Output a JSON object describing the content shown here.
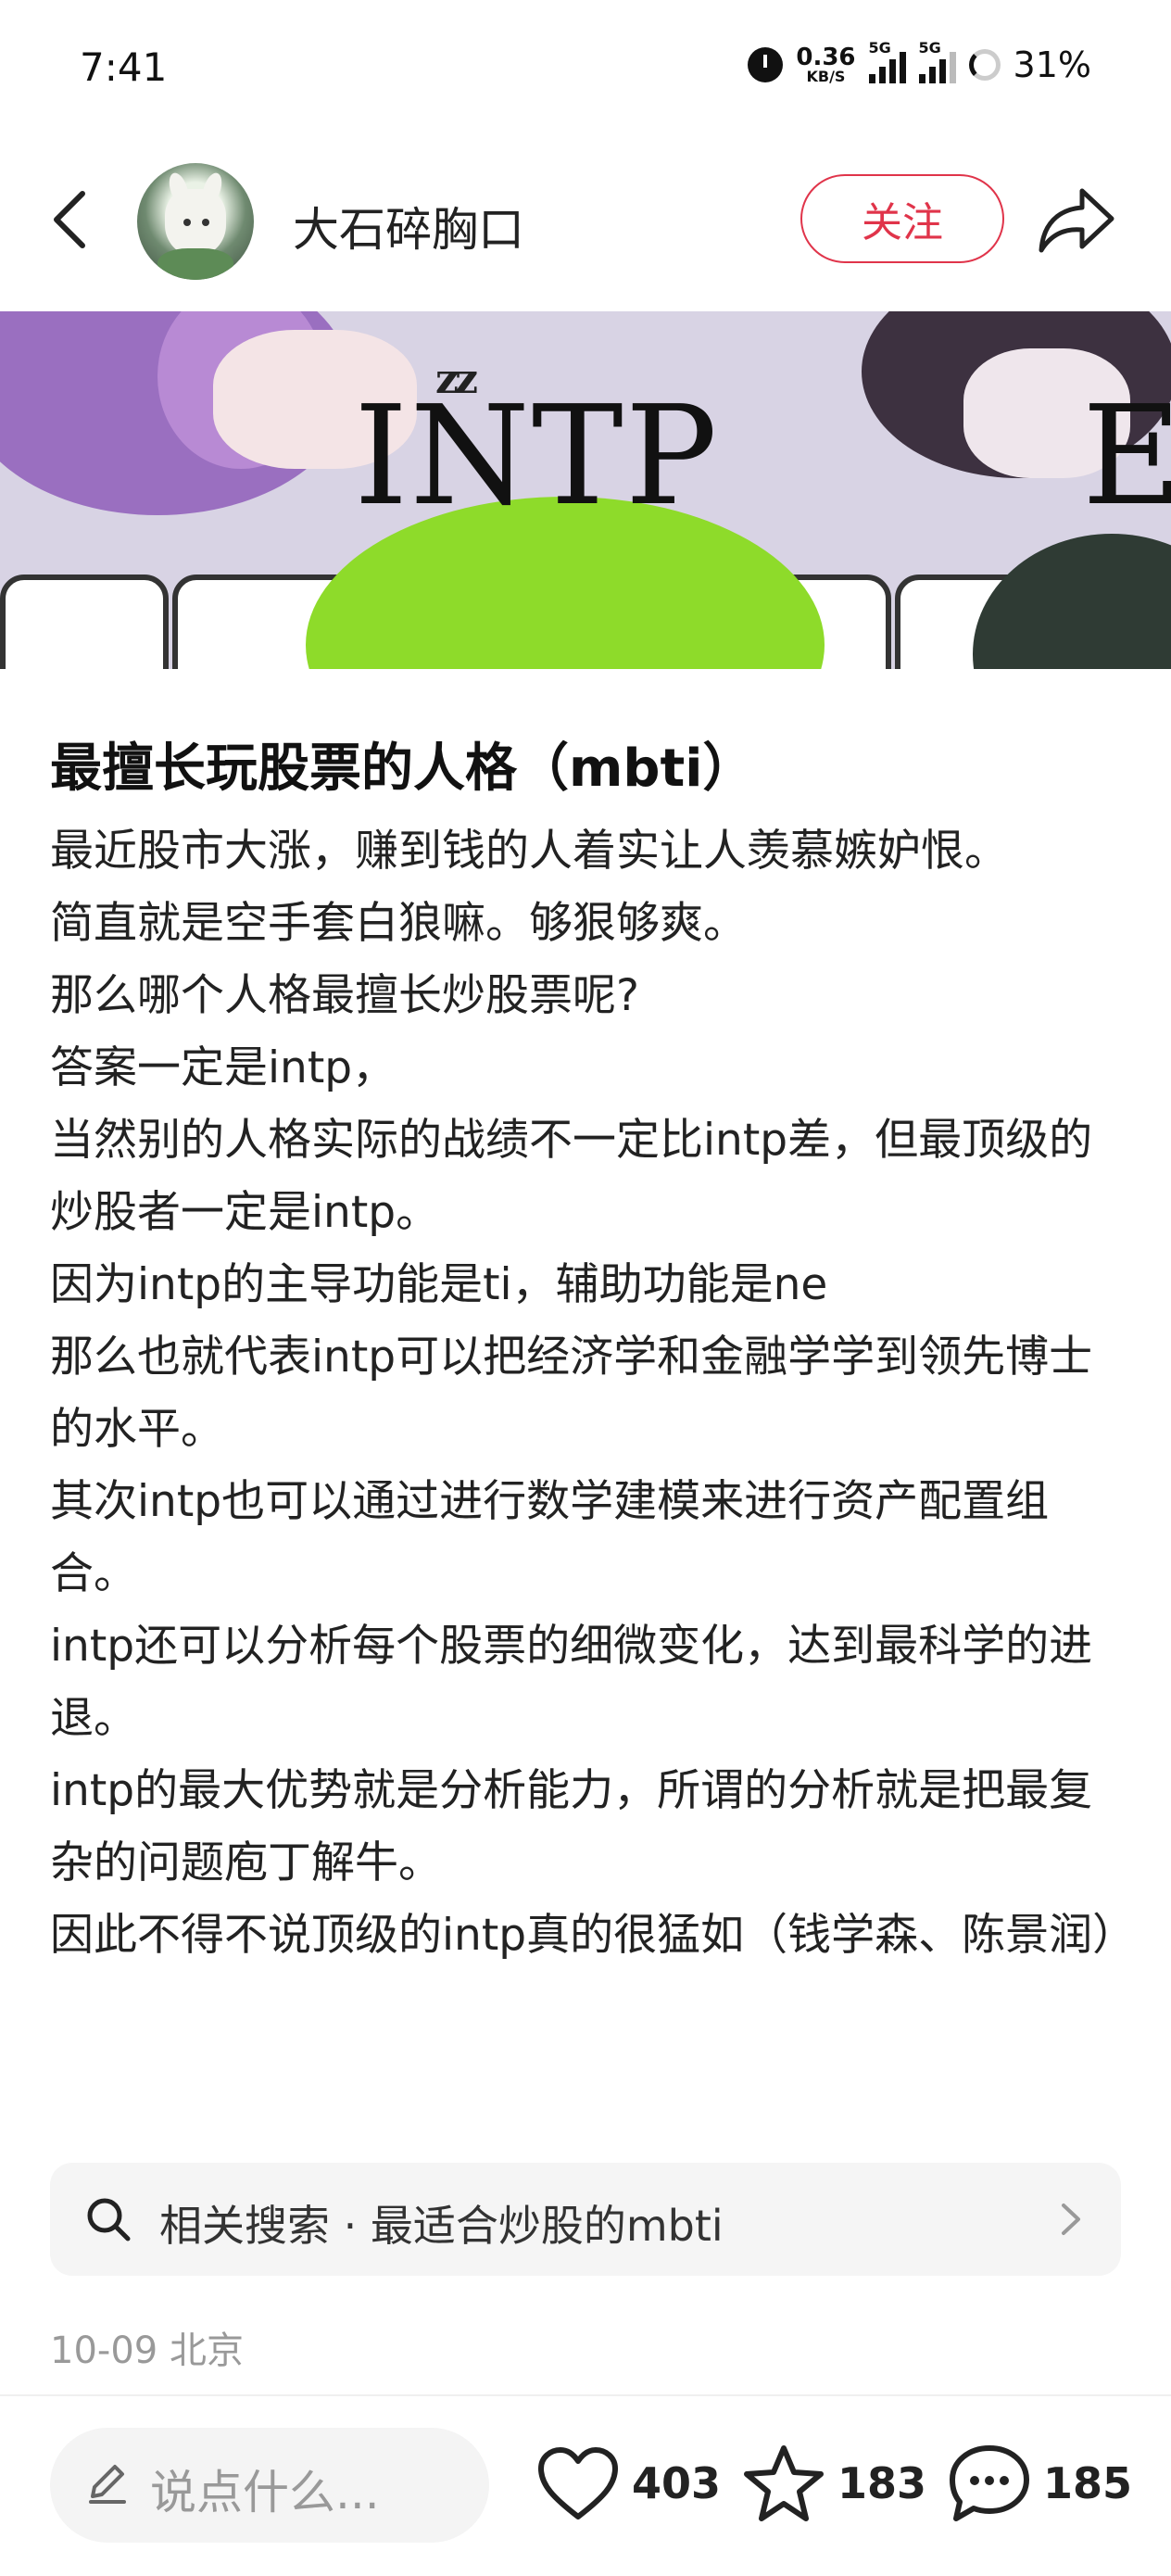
{
  "status": {
    "time": "7:41",
    "net_speed": "0.36",
    "net_unit": "KB/S",
    "sig1_label": "5G",
    "sig2_label": "5G",
    "battery": "31%"
  },
  "header": {
    "username": "大石碎胸口",
    "follow_label": "关注"
  },
  "image": {
    "overlay_text": "INTP",
    "sleep_text": "zz",
    "edge_text": "E"
  },
  "post": {
    "title": "最擅长玩股票的人格（mbti）",
    "paragraphs": [
      "最近股市大涨，赚到钱的人着实让人羡慕嫉妒恨。",
      "简直就是空手套白狼嘛。够狠够爽。",
      "那么哪个人格最擅长炒股票呢?",
      "答案一定是intp，",
      "当然别的人格实际的战绩不一定比intp差，但最顶级的炒股者一定是intp。",
      "因为intp的主导功能是ti，辅助功能是ne",
      "那么也就代表intp可以把经济学和金融学学到领先博士的水平。",
      "其次intp也可以通过进行数学建模来进行资产配置组合。",
      "intp还可以分析每个股票的细微变化，达到最科学的进退。",
      "intp的最大优势就是分析能力，所谓的分析就是把最复杂的问题庖丁解牛。",
      "因此不得不说顶级的intp真的很猛如（钱学森、陈景润）"
    ],
    "related_search": "相关搜索 · 最适合炒股的mbti",
    "meta": "10-09 北京"
  },
  "bottom": {
    "comment_placeholder": "说点什么...",
    "likes": "403",
    "stars": "183",
    "comments": "185"
  }
}
